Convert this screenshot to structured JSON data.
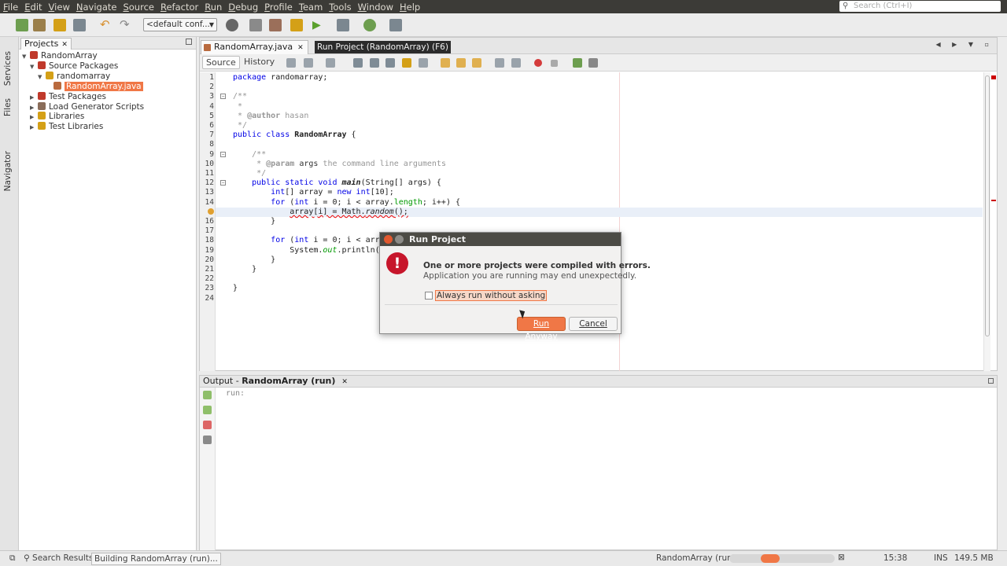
{
  "menubar": {
    "items": [
      {
        "u": "F",
        "rest": "ile"
      },
      {
        "u": "E",
        "rest": "dit"
      },
      {
        "u": "V",
        "rest": "iew"
      },
      {
        "u": "N",
        "rest": "avigate"
      },
      {
        "u": "S",
        "rest": "ource"
      },
      {
        "u": "R",
        "rest": "efactor"
      },
      {
        "u": "R",
        "rest": "un"
      },
      {
        "u": "D",
        "rest": "ebug"
      },
      {
        "u": "P",
        "rest": "rofile"
      },
      {
        "u": "T",
        "rest": "eam"
      },
      {
        "u": "T",
        "rest": "ools"
      },
      {
        "u": "W",
        "rest": "indow"
      },
      {
        "u": "H",
        "rest": "elp"
      }
    ],
    "search_placeholder": "Search (Ctrl+I)"
  },
  "toolbar": {
    "config": "<default conf..."
  },
  "left_strip": {
    "tabs": [
      "Services",
      "Files",
      "Navigator"
    ]
  },
  "projects": {
    "tab_label": "Projects",
    "tree": [
      {
        "label": "RandomArray",
        "depth": 0,
        "toggle": "▼",
        "color": "#c0392b"
      },
      {
        "label": "Source Packages",
        "depth": 1,
        "toggle": "▼",
        "color": "#c0392b"
      },
      {
        "label": "randomarray",
        "depth": 2,
        "toggle": "▼",
        "color": "#d4a017"
      },
      {
        "label": "RandomArray.java",
        "depth": 3,
        "toggle": "",
        "color": "#b96a3e",
        "selected": true
      },
      {
        "label": "Test Packages",
        "depth": 1,
        "toggle": "▶",
        "color": "#c0392b"
      },
      {
        "label": "Load Generator Scripts",
        "depth": 1,
        "toggle": "▶",
        "color": "#8a6d5a"
      },
      {
        "label": "Libraries",
        "depth": 1,
        "toggle": "▶",
        "color": "#d4a017"
      },
      {
        "label": "Test Libraries",
        "depth": 1,
        "toggle": "▶",
        "color": "#d4a017"
      }
    ]
  },
  "editor": {
    "tab_label": "RandomArray.java",
    "tooltip": "Run Project (RandomArray) (F6)",
    "source_label": "Source",
    "history_label": "History",
    "line_numbers": [
      "1",
      "2",
      "3",
      "4",
      "5",
      "6",
      "7",
      "8",
      "9",
      "10",
      "11",
      "12",
      "13",
      "14",
      "15",
      "16",
      "17",
      "18",
      "19",
      "20",
      "21",
      "22",
      "23",
      "24"
    ]
  },
  "output": {
    "tab_prefix": "Output - ",
    "tab_name": "RandomArray (run)",
    "text": "run:"
  },
  "statusbar": {
    "search_results": "Search Results",
    "building": "Building RandomArray (run)...",
    "task": "RandomArray (run)",
    "progress": 0.45,
    "time": "15:38",
    "mode": "INS",
    "memory": "149.5 MB"
  },
  "dialog": {
    "title": "Run Project",
    "message": "One or more projects were compiled with errors.",
    "submessage": "Application you are running may end unexpectedly.",
    "checkbox_label": "Always run without asking",
    "run_anyway": "Run Anyway",
    "cancel": "Cancel"
  },
  "colors": {
    "accent": "#f07746",
    "error": "#c7162b",
    "menubar_bg": "#3c3b37",
    "keyword": "#0000e6"
  }
}
